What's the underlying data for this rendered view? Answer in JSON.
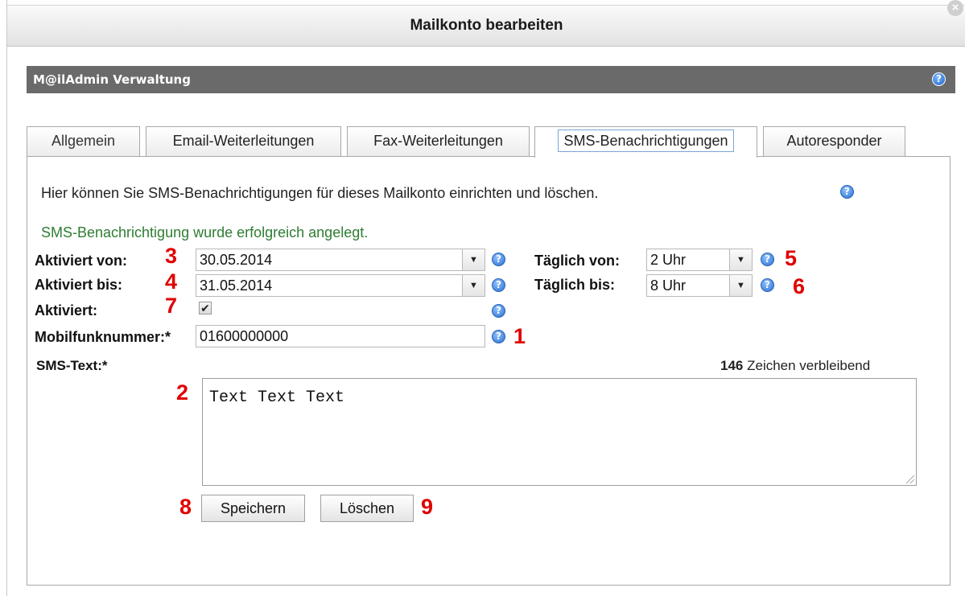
{
  "window": {
    "title": "Mailkonto bearbeiten",
    "close_icon": "close-icon"
  },
  "admin_bar": {
    "title": "M@ilAdmin Verwaltung",
    "help_icon": "help-icon"
  },
  "tabs": [
    {
      "label": "Allgemein",
      "active": false
    },
    {
      "label": "Email-Weiterleitungen",
      "active": false
    },
    {
      "label": "Fax-Weiterleitungen",
      "active": false
    },
    {
      "label": "SMS-Benachrichtigungen",
      "active": true
    },
    {
      "label": "Autoresponder",
      "active": false
    }
  ],
  "content": {
    "intro": "Hier können Sie SMS-Benachrichtigungen für dieses Mailkonto einrichten und löschen.",
    "success": "SMS-Benachrichtigung wurde erfolgreich angelegt.",
    "aktiviert_von": {
      "label": "Aktiviert von:",
      "value": "30.05.2014",
      "annotation": "3"
    },
    "aktiviert_bis": {
      "label": "Aktiviert bis:",
      "value": "31.05.2014",
      "annotation": "4"
    },
    "aktiviert": {
      "label": "Aktiviert:",
      "checked": true,
      "check_glyph": "✔",
      "annotation": "7"
    },
    "mobil": {
      "label": "Mobilfunknummer:*",
      "value": "01600000000",
      "annotation": "1"
    },
    "taeglich_von": {
      "label": "Täglich von:",
      "value": "2 Uhr",
      "annotation": "5"
    },
    "taeglich_bis": {
      "label": "Täglich bis:",
      "value": "8 Uhr",
      "annotation": "6"
    },
    "sms_text": {
      "label": "SMS-Text:*",
      "value": "Text Text Text",
      "annotation": "2"
    },
    "remaining": {
      "count": "146",
      "suffix": "Zeichen verbleibend"
    },
    "save": {
      "label": "Speichern",
      "annotation": "8"
    },
    "delete": {
      "label": "Löschen",
      "annotation": "9"
    },
    "help_glyph": "?",
    "dropdown_glyph": "▼"
  },
  "colors": {
    "annotation": "#e00000",
    "success": "#2e7d32",
    "admin_bar": "#6a6a6a",
    "help": "#2a6fcf"
  }
}
